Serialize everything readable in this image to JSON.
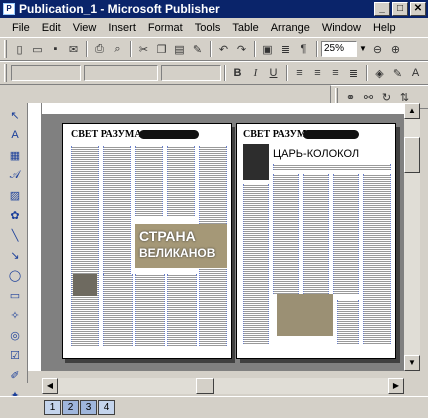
{
  "window": {
    "title": "Publication_1 - Microsoft Publisher",
    "icon": "publisher-icon"
  },
  "menu": [
    "File",
    "Edit",
    "View",
    "Insert",
    "Format",
    "Tools",
    "Table",
    "Arrange",
    "Window",
    "Help"
  ],
  "standard_toolbar": {
    "zoom": "25%"
  },
  "formatting_toolbar": {
    "bold": "B",
    "italic": "I",
    "underline": "U"
  },
  "pages": {
    "left": {
      "header": "СВЕТ РАЗУМА",
      "big_title_1": "СТРАНА",
      "big_title_2": "ВЕЛИКАНОВ"
    },
    "right": {
      "header": "СВЕТ РАЗУМА",
      "headline": "ЦАРЬ-КОЛОКОЛ"
    }
  },
  "page_tabs": [
    "1",
    "2",
    "3",
    "4"
  ]
}
